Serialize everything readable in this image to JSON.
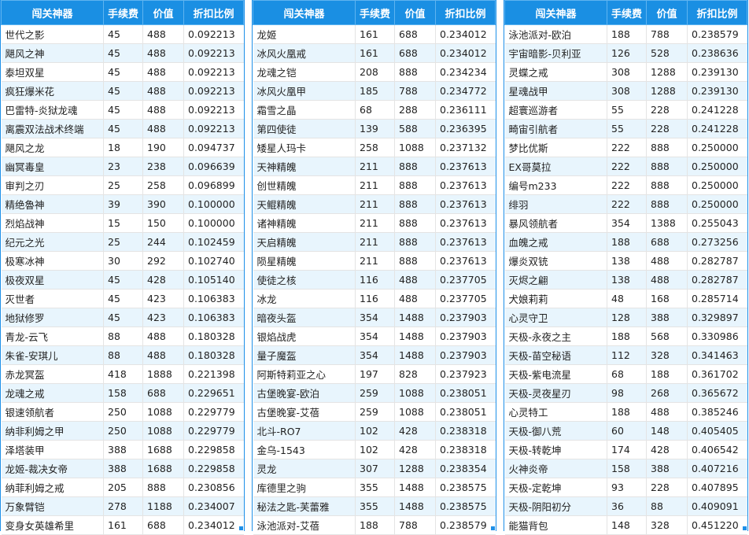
{
  "headers": {
    "name": "闯关神器",
    "fee": "手续费",
    "value": "价值",
    "ratio": "折扣比例"
  },
  "tables": [
    {
      "rows": [
        [
          "世代之影",
          "45",
          "488",
          "0.092213"
        ],
        [
          "飓风之神",
          "45",
          "488",
          "0.092213"
        ],
        [
          "泰坦双星",
          "45",
          "488",
          "0.092213"
        ],
        [
          "疯狂爆米花",
          "45",
          "488",
          "0.092213"
        ],
        [
          "巴雷特-炎狱龙魂",
          "45",
          "488",
          "0.092213"
        ],
        [
          "离震双法战术终端",
          "45",
          "488",
          "0.092213"
        ],
        [
          "飓风之龙",
          "18",
          "190",
          "0.094737"
        ],
        [
          "幽冥毒皇",
          "23",
          "238",
          "0.096639"
        ],
        [
          "审判之刃",
          "25",
          "258",
          "0.096899"
        ],
        [
          "精绝魯神",
          "39",
          "390",
          "0.100000"
        ],
        [
          "烈焰战神",
          "15",
          "150",
          "0.100000"
        ],
        [
          "纪元之光",
          "25",
          "244",
          "0.102459"
        ],
        [
          "极寒冰神",
          "30",
          "292",
          "0.102740"
        ],
        [
          "极夜双星",
          "45",
          "428",
          "0.105140"
        ],
        [
          "灭世者",
          "45",
          "423",
          "0.106383"
        ],
        [
          "地狱修罗",
          "45",
          "423",
          "0.106383"
        ],
        [
          "青龙-云飞",
          "88",
          "488",
          "0.180328"
        ],
        [
          "朱雀-安琪儿",
          "88",
          "488",
          "0.180328"
        ],
        [
          "赤龙冥盔",
          "418",
          "1888",
          "0.221398"
        ],
        [
          "龙魂之戒",
          "158",
          "688",
          "0.229651"
        ],
        [
          "银速领航者",
          "250",
          "1088",
          "0.229779"
        ],
        [
          "纳非利姆之甲",
          "250",
          "1088",
          "0.229779"
        ],
        [
          "泽塔装甲",
          "388",
          "1688",
          "0.229858"
        ],
        [
          "龙姬-裁决女帝",
          "388",
          "1688",
          "0.229858"
        ],
        [
          "纳菲利姆之戒",
          "205",
          "888",
          "0.230856"
        ],
        [
          "万象臂铠",
          "278",
          "1188",
          "0.234007"
        ],
        [
          "变身女英雄希里",
          "161",
          "688",
          "0.234012"
        ]
      ]
    },
    {
      "rows": [
        [
          "龙姬",
          "161",
          "688",
          "0.234012"
        ],
        [
          "冰风火凰戒",
          "161",
          "688",
          "0.234012"
        ],
        [
          "龙魂之铠",
          "208",
          "888",
          "0.234234"
        ],
        [
          "冰风火凰甲",
          "185",
          "788",
          "0.234772"
        ],
        [
          "霜雪之晶",
          "68",
          "288",
          "0.236111"
        ],
        [
          "第四使徒",
          "139",
          "588",
          "0.236395"
        ],
        [
          "矮星人玛卡",
          "258",
          "1088",
          "0.237132"
        ],
        [
          "天神精魄",
          "211",
          "888",
          "0.237613"
        ],
        [
          "创世精魄",
          "211",
          "888",
          "0.237613"
        ],
        [
          "天鲲精魄",
          "211",
          "888",
          "0.237613"
        ],
        [
          "诸神精魄",
          "211",
          "888",
          "0.237613"
        ],
        [
          "天启精魄",
          "211",
          "888",
          "0.237613"
        ],
        [
          "陨星精魄",
          "211",
          "888",
          "0.237613"
        ],
        [
          "使徒之核",
          "116",
          "488",
          "0.237705"
        ],
        [
          "冰龙",
          "116",
          "488",
          "0.237705"
        ],
        [
          "暗夜头盔",
          "354",
          "1488",
          "0.237903"
        ],
        [
          "银焰战虎",
          "354",
          "1488",
          "0.237903"
        ],
        [
          "量子魔盔",
          "354",
          "1488",
          "0.237903"
        ],
        [
          "阿斯特莉亚之心",
          "197",
          "828",
          "0.237923"
        ],
        [
          "古堡晚宴-欧泊",
          "259",
          "1088",
          "0.238051"
        ],
        [
          "古堡晚宴-艾蓓",
          "259",
          "1088",
          "0.238051"
        ],
        [
          "北斗-RO7",
          "102",
          "428",
          "0.238318"
        ],
        [
          "金乌-1543",
          "102",
          "428",
          "0.238318"
        ],
        [
          "灵龙",
          "307",
          "1288",
          "0.238354"
        ],
        [
          "库德里之驹",
          "355",
          "1488",
          "0.238575"
        ],
        [
          "秘法之匙-芙蕾雅",
          "355",
          "1488",
          "0.238575"
        ],
        [
          "泳池派对-艾蓓",
          "188",
          "788",
          "0.238579"
        ]
      ]
    },
    {
      "rows": [
        [
          "泳池派对-欧泊",
          "188",
          "788",
          "0.238579"
        ],
        [
          "宇宙暗影-贝利亚",
          "126",
          "528",
          "0.238636"
        ],
        [
          "灵蝶之戒",
          "308",
          "1288",
          "0.239130"
        ],
        [
          "星魂战甲",
          "308",
          "1288",
          "0.239130"
        ],
        [
          "超寰巡游者",
          "55",
          "228",
          "0.241228"
        ],
        [
          "畸宙引航者",
          "55",
          "228",
          "0.241228"
        ],
        [
          "梦比优斯",
          "222",
          "888",
          "0.250000"
        ],
        [
          "EX哥莫拉",
          "222",
          "888",
          "0.250000"
        ],
        [
          "编号m233",
          "222",
          "888",
          "0.250000"
        ],
        [
          "绯羽",
          "222",
          "888",
          "0.250000"
        ],
        [
          "暴风领航者",
          "354",
          "1388",
          "0.255043"
        ],
        [
          "血魄之戒",
          "188",
          "688",
          "0.273256"
        ],
        [
          "爆炎双铳",
          "138",
          "488",
          "0.282787"
        ],
        [
          "灭烬之翩",
          "138",
          "488",
          "0.282787"
        ],
        [
          "犬娘莉莉",
          "48",
          "168",
          "0.285714"
        ],
        [
          "心灵守卫",
          "128",
          "388",
          "0.329897"
        ],
        [
          "天极-永夜之主",
          "188",
          "568",
          "0.330986"
        ],
        [
          "天极-苗空秘语",
          "112",
          "328",
          "0.341463"
        ],
        [
          "天极-紫电流星",
          "68",
          "188",
          "0.361702"
        ],
        [
          "天极-灵夜星刃",
          "98",
          "268",
          "0.365672"
        ],
        [
          "心灵特工",
          "188",
          "488",
          "0.385246"
        ],
        [
          "天极-御八荒",
          "60",
          "148",
          "0.405405"
        ],
        [
          "天极-转乾坤",
          "174",
          "428",
          "0.406542"
        ],
        [
          "火神炎帝",
          "158",
          "388",
          "0.407216"
        ],
        [
          "天极-定乾坤",
          "93",
          "228",
          "0.407895"
        ],
        [
          "天极-阴阳初分",
          "36",
          "88",
          "0.409091"
        ],
        [
          "能猫背包",
          "148",
          "328",
          "0.451220"
        ]
      ]
    }
  ]
}
